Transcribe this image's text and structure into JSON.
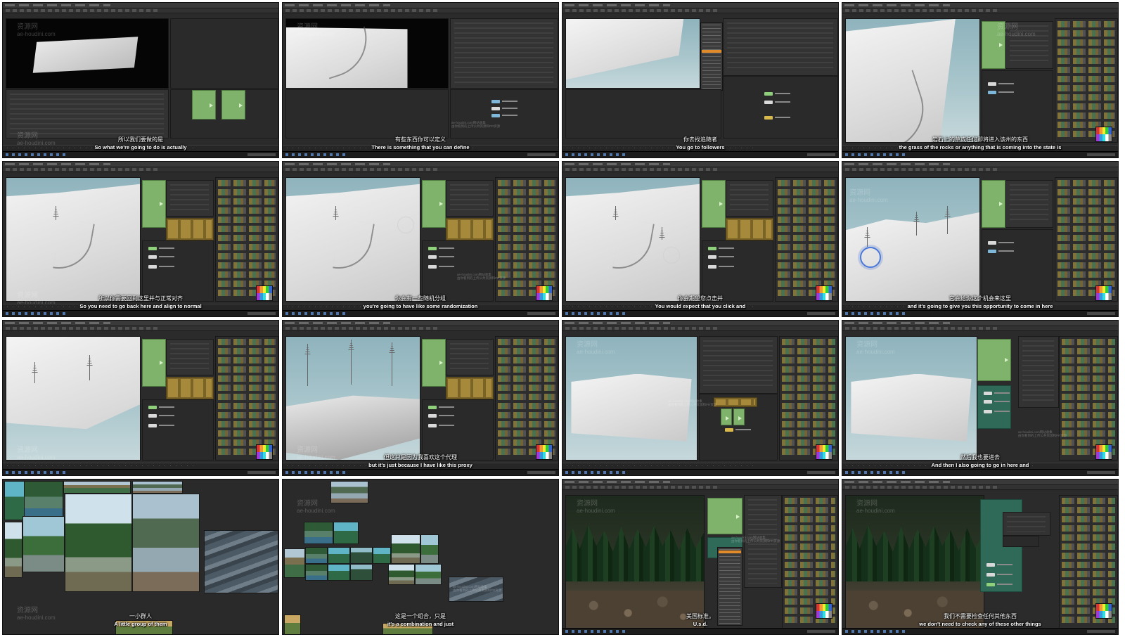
{
  "watermark": {
    "site_cn": "资源网",
    "site_url": "ae-houdini.com",
    "note_line1": "ae-houdini.com网站收集",
    "note_line2": "由你看到的上传公共资源和PR资源"
  },
  "frames": [
    {
      "caption_zh": "所以我们要做的是",
      "caption_en": "So what we're going to do is actually"
    },
    {
      "caption_zh": "有些东西你可以定义",
      "caption_en": "There is something that you can define"
    },
    {
      "caption_zh": "你去找追随者",
      "caption_en": "You go to followers"
    },
    {
      "caption_zh": "岩石上的草或任何即将进入该州的东西",
      "caption_en": "the grass of the rocks or anything that is coming into the state is"
    },
    {
      "caption_zh": "所以你需要回到这里并与正常对齐",
      "caption_en": "So you need to go back here and align to normal"
    },
    {
      "caption_zh": "你会有一些随机分组",
      "caption_en": "you're going to have like some randomization"
    },
    {
      "caption_zh": "你会期望您点击并",
      "caption_en": "You would expect that you click and"
    },
    {
      "caption_zh": "它会给你这个机会来这里",
      "caption_en": "and it's going to give you this opportunity to come in here"
    },
    {
      "caption_zh": "",
      "caption_en": ""
    },
    {
      "caption_zh": "但这只是因为我喜欢这个代理",
      "caption_en": "but it's just because I have like this proxy"
    },
    {
      "caption_zh": "",
      "caption_en": ""
    },
    {
      "caption_zh": "然后我也要进去",
      "caption_en": "And then I also going to go in here and"
    },
    {
      "caption_zh": "一小群人",
      "caption_en": "A little group of them"
    },
    {
      "caption_zh": "这是一个组合，只是",
      "caption_en": "it's a combination and just"
    },
    {
      "caption_zh": "美国标准。",
      "caption_en": "U.s.d."
    },
    {
      "caption_zh": "我们不需要检查任何其他东西",
      "caption_en": "we don't need to check any of these other things"
    }
  ],
  "colors": {
    "app_bg": "#2b2b2b",
    "panel_bg": "#333333",
    "node_green": "#7fb36b",
    "node_teal": "#2f6a58",
    "viewport_sky": "#a9c6cc",
    "selection_orange": "#e08a2a",
    "cursor_blue": "#4a78d8"
  }
}
